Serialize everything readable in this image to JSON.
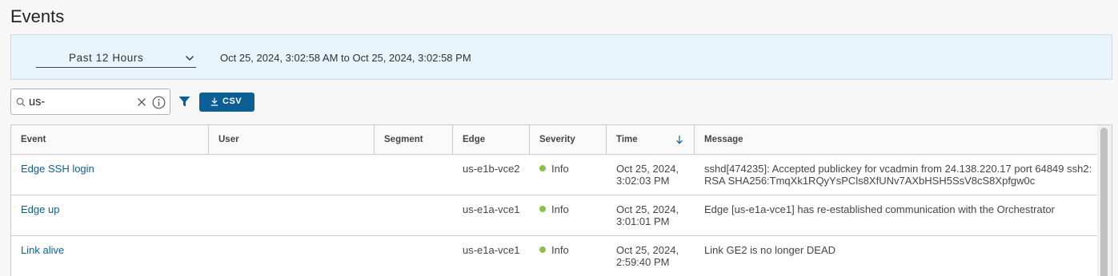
{
  "page": {
    "title": "Events"
  },
  "time_range": {
    "selected": "Past 12 Hours",
    "range_text": "Oct 25, 2024, 3:02:58 AM to Oct 25, 2024, 3:02:58 PM"
  },
  "toolbar": {
    "search_value": "us-",
    "csv_label": "CSV"
  },
  "table": {
    "columns": [
      "Event",
      "User",
      "Segment",
      "Edge",
      "Severity",
      "Time",
      "Message"
    ],
    "sorted_column": "Time",
    "sort_direction": "descending",
    "rows": [
      {
        "event": "Edge SSH login",
        "user": "",
        "segment": "",
        "edge": "us-e1b-vce2",
        "severity": "Info",
        "time": "Oct 25, 2024, 3:02:03 PM",
        "message": "sshd[474235]: Accepted publickey for vcadmin from 24.138.220.17 port 64849 ssh2: RSA SHA256:TmqXk1RQyYsPCls8XfUNv7AXbHSH5SsV8cS8Xpfgw0c"
      },
      {
        "event": "Edge up",
        "user": "",
        "segment": "",
        "edge": "us-e1a-vce1",
        "severity": "Info",
        "time": "Oct 25, 2024, 3:01:01 PM",
        "message": "Edge [us-e1a-vce1] has re-established communication with the Orchestrator"
      },
      {
        "event": "Link alive",
        "user": "",
        "segment": "",
        "edge": "us-e1a-vce1",
        "severity": "Info",
        "time": "Oct 25, 2024, 2:59:40 PM",
        "message": "Link GE2 is no longer DEAD"
      }
    ]
  },
  "colors": {
    "accent": "#0a5f94",
    "info_dot": "#8bc34a",
    "range_panel_bg": "#e8f4fb"
  },
  "icons": {
    "search": "search-icon",
    "clear": "close-icon",
    "info": "info-icon",
    "filter": "filter-icon",
    "download": "download-icon",
    "chevron": "chevron-down-icon",
    "sort": "arrow-down-icon"
  }
}
